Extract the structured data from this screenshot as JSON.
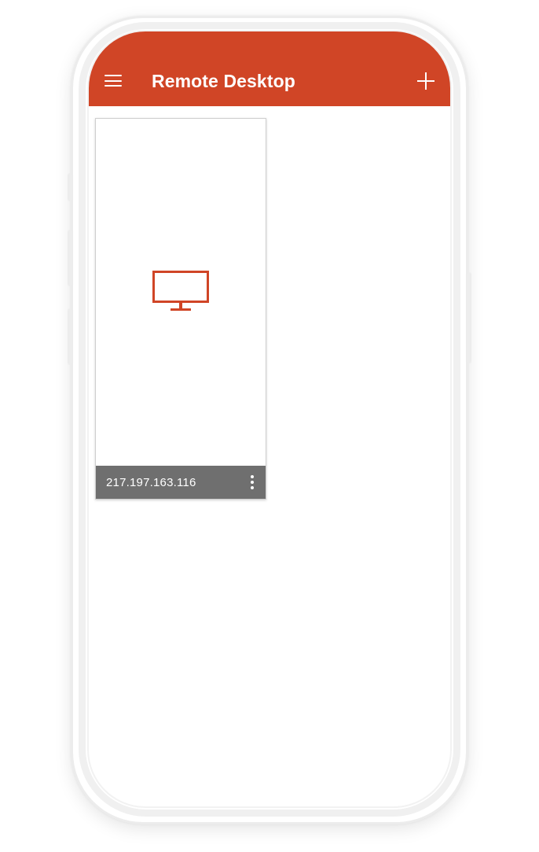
{
  "app": {
    "title": "Remote Desktop",
    "accent_color": "#D04526"
  },
  "appbar": {
    "menu_icon": "hamburger-menu-icon",
    "add_icon": "plus-icon"
  },
  "connections": [
    {
      "label": "217.197.163.116",
      "icon": "monitor-icon",
      "more_icon": "more-vertical-icon"
    }
  ]
}
